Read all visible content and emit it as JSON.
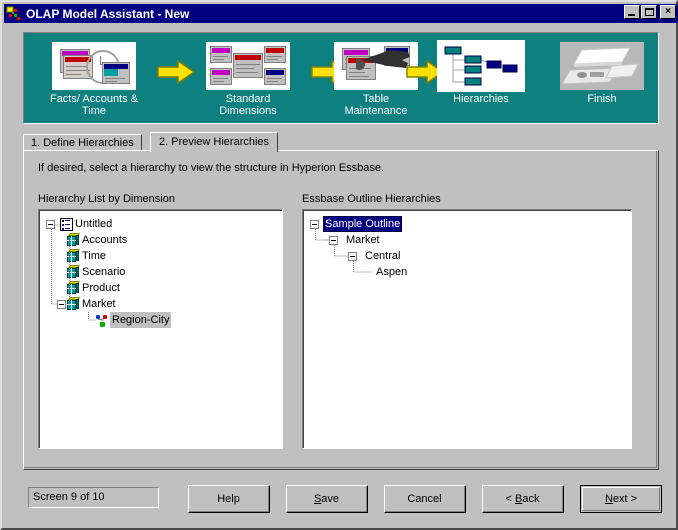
{
  "window": {
    "title": "OLAP Model Assistant - New",
    "icon": "app-icon",
    "controls": {
      "minimize": "minimize-button",
      "maximize": "maximize-button",
      "close": "close-button",
      "close_glyph": "×"
    }
  },
  "banner": {
    "background_color": "#0f8080",
    "steps": [
      {
        "caption": "Facts/ Accounts &\nTime",
        "icon": "facts-accounts-time-icon",
        "current": false,
        "arrow_after": true
      },
      {
        "caption": "Standard\nDimensions",
        "icon": "standard-dimensions-icon",
        "current": false,
        "arrow_after": true
      },
      {
        "caption": "Table\nMaintenance",
        "icon": "table-maintenance-icon",
        "current": false,
        "arrow_after": true
      },
      {
        "caption": "Hierarchies",
        "icon": "hierarchies-icon",
        "current": true,
        "arrow_after": false
      },
      {
        "caption": "Finish",
        "icon": "finish-icon",
        "current": false,
        "arrow_after": false
      }
    ]
  },
  "tabs": [
    {
      "label": "1. Define Hierarchies",
      "active": false
    },
    {
      "label": "2. Preview Hierarchies",
      "active": true
    }
  ],
  "panel": {
    "instruction": "If desired, select a hierarchy to view the structure in Hyperion Essbase.",
    "left_group_label": "Hierarchy List by Dimension",
    "right_group_label": "Essbase Outline Hierarchies"
  },
  "left_tree": {
    "nodes": [
      {
        "label": "Untitled",
        "depth": 0,
        "icon": "document-icon",
        "expander": "minus",
        "selected": "none"
      },
      {
        "label": "Accounts",
        "depth": 1,
        "icon": "dimension-cube-icon",
        "expander": "none",
        "selected": "none"
      },
      {
        "label": "Time",
        "depth": 1,
        "icon": "dimension-cube-icon",
        "expander": "none",
        "selected": "none"
      },
      {
        "label": "Scenario",
        "depth": 1,
        "icon": "dimension-cube-icon",
        "expander": "none",
        "selected": "none"
      },
      {
        "label": "Product",
        "depth": 1,
        "icon": "dimension-cube-icon",
        "expander": "none",
        "selected": "none"
      },
      {
        "label": "Market",
        "depth": 1,
        "icon": "dimension-cube-icon",
        "expander": "minus",
        "selected": "none"
      },
      {
        "label": "Region-City",
        "depth": 2,
        "icon": "hierarchy-node-icon",
        "expander": "none",
        "selected": "gray"
      }
    ]
  },
  "right_tree": {
    "nodes": [
      {
        "label": "Sample Outline",
        "depth": 0,
        "icon": "none",
        "expander": "minus",
        "selected": "blue"
      },
      {
        "label": "Market",
        "depth": 1,
        "icon": "none",
        "expander": "minus",
        "selected": "none"
      },
      {
        "label": "Central",
        "depth": 2,
        "icon": "none",
        "expander": "minus",
        "selected": "none"
      },
      {
        "label": "Aspen",
        "depth": 3,
        "icon": "none",
        "expander": "none",
        "selected": "none"
      }
    ]
  },
  "footer": {
    "status": "Screen 9 of 10",
    "buttons": [
      {
        "name": "help-button",
        "label": "Help",
        "accel": "",
        "default": false
      },
      {
        "name": "save-button",
        "label": "Save",
        "accel": "S",
        "default": false
      },
      {
        "name": "cancel-button",
        "label": "Cancel",
        "accel": "",
        "default": false
      },
      {
        "name": "back-button",
        "label": "< Back",
        "accel": "B",
        "default": false
      },
      {
        "name": "next-button",
        "label": "Next >",
        "accel": "N",
        "default": true
      }
    ]
  }
}
